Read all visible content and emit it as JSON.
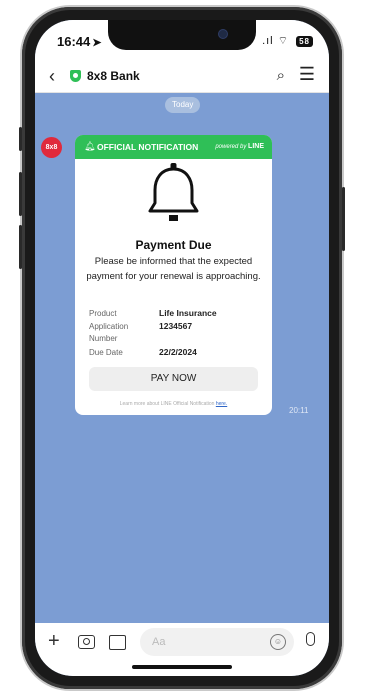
{
  "status_bar": {
    "time": "16:44",
    "time_arrow": "➤",
    "battery": "58"
  },
  "header": {
    "back_glyph": "‹",
    "title": "8x8 Bank",
    "search_glyph": "⌕",
    "menu_glyph": "☰",
    "verified_icon": "shield-check-icon"
  },
  "chat": {
    "date_label": "Today",
    "avatar_text": "8x8",
    "message_time": "20:11",
    "card": {
      "header_title": "OFFICIAL NOTIFICATION",
      "powered_by": "powered by",
      "powered_brand": "LINE",
      "title": "Payment Due",
      "body": "Please be informed that the expected payment for your renewal is approaching.",
      "fields": [
        {
          "label": "Product",
          "value": "Life Insurance"
        },
        {
          "label": "Application Number",
          "value": "1234567"
        },
        {
          "label": "Due Date",
          "value": "22/2/2024"
        }
      ],
      "button_label": "PAY NOW",
      "footer_text": "Learn more about LINE Official Notification",
      "footer_link": "here."
    }
  },
  "input_bar": {
    "placeholder": "Aa",
    "plus_glyph": "+"
  },
  "colors": {
    "accent_green": "#2fbf57",
    "chat_background": "#7c9dd3",
    "avatar_red": "#e02a3c"
  }
}
